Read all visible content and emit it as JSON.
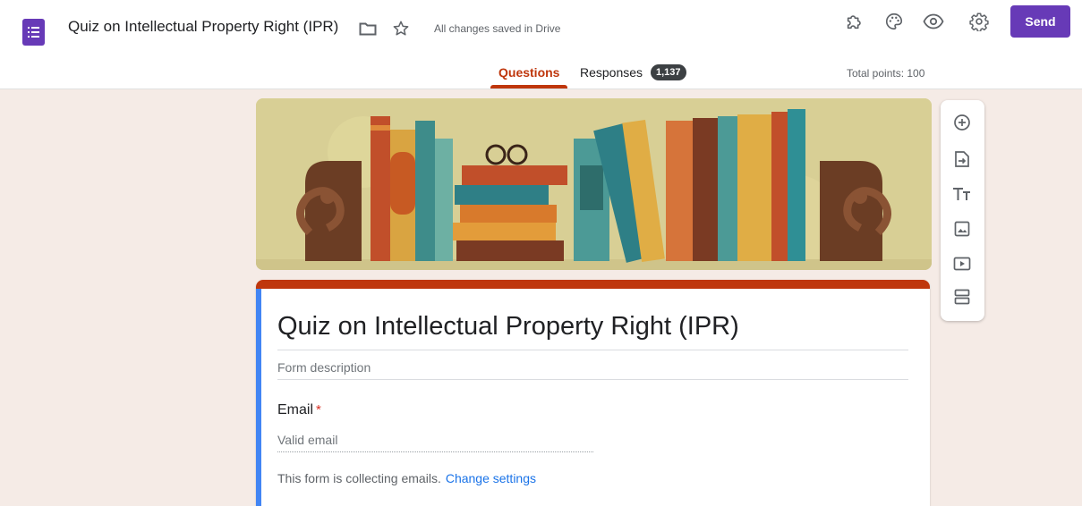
{
  "header": {
    "app_icon": "google-forms-icon",
    "document_title": "Quiz on Intellectual Property Right (IPR)",
    "saved_status": "All changes saved in Drive",
    "icons": [
      "folder-icon",
      "star-icon",
      "addon-puzzle-icon",
      "palette-icon",
      "preview-eye-icon",
      "settings-gear-icon"
    ],
    "send_label": "Send",
    "accent_color": "#673ab7"
  },
  "tabs": {
    "questions_label": "Questions",
    "responses_label": "Responses",
    "responses_count": "1,137",
    "active": "Questions",
    "active_color": "#bf360c"
  },
  "total_points": "Total points: 100",
  "form": {
    "header_image": "bookshelf-illustration",
    "title": "Quiz on Intellectual Property Right (IPR)",
    "description_placeholder": "Form description",
    "theme_color": "#bf360c",
    "focus_color": "#4285f4"
  },
  "email_question": {
    "label": "Email",
    "required_mark": "*",
    "input_placeholder": "Valid email",
    "notice_text": "This form is collecting emails.",
    "notice_link": "Change settings",
    "link_color": "#1a73e8"
  },
  "toolbar": {
    "items": [
      "add-question-icon",
      "import-questions-icon",
      "add-title-icon",
      "add-image-icon",
      "add-video-icon",
      "add-section-icon"
    ]
  }
}
